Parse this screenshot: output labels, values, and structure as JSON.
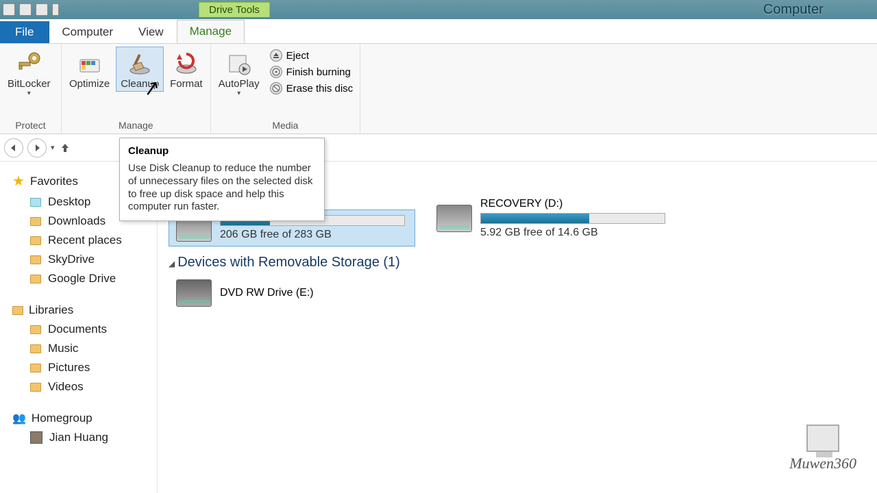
{
  "window": {
    "title": "Computer",
    "contextual_tab": "Drive Tools"
  },
  "tabs": {
    "file": "File",
    "computer": "Computer",
    "view": "View",
    "manage": "Manage"
  },
  "ribbon": {
    "protect": {
      "bitlocker": "BitLocker",
      "group": "Protect"
    },
    "manage": {
      "optimize": "Optimize",
      "cleanup": "Cleanup",
      "format": "Format",
      "group": "Manage"
    },
    "media": {
      "autoplay": "AutoPlay",
      "eject": "Eject",
      "finish": "Finish burning",
      "erase": "Erase this disc",
      "group": "Media"
    }
  },
  "tooltip": {
    "title": "Cleanup",
    "body": "Use Disk Cleanup to reduce the number of unnecessary files on the selected disk to free up disk space and help this computer run faster."
  },
  "sidebar": {
    "favorites": "Favorites",
    "items_fav": [
      "Desktop",
      "Downloads",
      "Recent places",
      "SkyDrive",
      "Google Drive"
    ],
    "libraries": "Libraries",
    "items_lib": [
      "Documents",
      "Music",
      "Pictures",
      "Videos"
    ],
    "homegroup": "Homegroup",
    "items_hg": [
      "Jian Huang"
    ]
  },
  "drives": {
    "c": {
      "name_hidden": true,
      "free": "206 GB free of 283 GB",
      "fill_pct": 27
    },
    "d": {
      "name": "RECOVERY (D:)",
      "free": "5.92 GB free of 14.6 GB",
      "fill_pct": 59
    },
    "removable_header": "Devices with Removable Storage (1)",
    "e": {
      "name": "DVD RW Drive (E:)"
    }
  },
  "watermark": "Muwen360"
}
